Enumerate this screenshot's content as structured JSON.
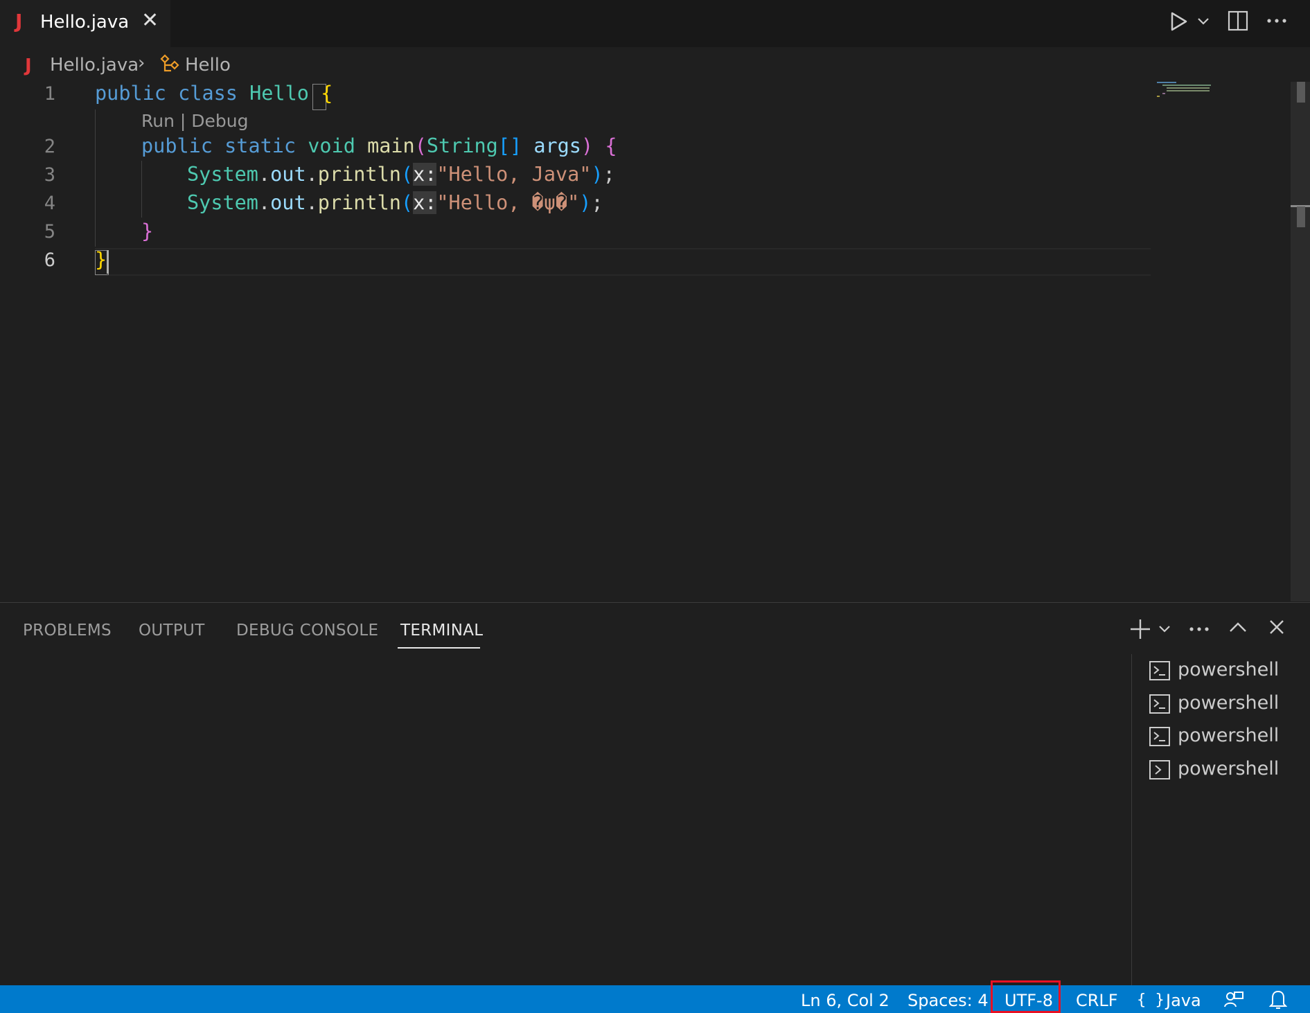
{
  "tab": {
    "icon": "java-icon",
    "icon_glyph": "J",
    "title": "Hello.java",
    "close_glyph": "✕"
  },
  "breadcrumb": {
    "file": "Hello.java",
    "separator": "›",
    "symbol": "Hello"
  },
  "editor": {
    "line_numbers": [
      "1",
      "2",
      "3",
      "4",
      "5",
      "6"
    ],
    "codelens": "Run | Debug",
    "lines": {
      "l1": {
        "kw1": "public",
        "kw2": "class",
        "name": "Hello",
        "brace": "{"
      },
      "l2": {
        "kw1": "public",
        "kw2": "static",
        "kw3": "void",
        "fn": "main",
        "p_open": "(",
        "type": "String",
        "brackets": "[]",
        "arg": "args",
        "p_close": ")",
        "brace": "{"
      },
      "l3": {
        "cls": "System",
        "dot1": ".",
        "field": "out",
        "dot2": ".",
        "fn": "println",
        "p_open": "(",
        "hint": "x:",
        "str": "\"Hello, Java\"",
        "p_close": ")",
        "semi": ";"
      },
      "l4": {
        "cls": "System",
        "dot1": ".",
        "field": "out",
        "dot2": ".",
        "fn": "println",
        "p_open": "(",
        "hint": "x:",
        "str": "\"Hello, �ψ�\"",
        "p_close": ")",
        "semi": ";"
      },
      "l5": {
        "brace": "}"
      },
      "l6": {
        "brace": "}"
      }
    }
  },
  "panel": {
    "tabs": [
      "PROBLEMS",
      "OUTPUT",
      "DEBUG CONSOLE",
      "TERMINAL"
    ],
    "active_tab": "TERMINAL",
    "terminals": [
      "powershell",
      "powershell",
      "powershell",
      "powershell"
    ]
  },
  "statusbar": {
    "position": "Ln 6, Col 2",
    "spaces": "Spaces: 4",
    "encoding": "UTF-8",
    "eol": "CRLF",
    "lang_icon": "{ }",
    "language": "Java",
    "background": "#007acc",
    "highlight_color": "#e81123"
  }
}
